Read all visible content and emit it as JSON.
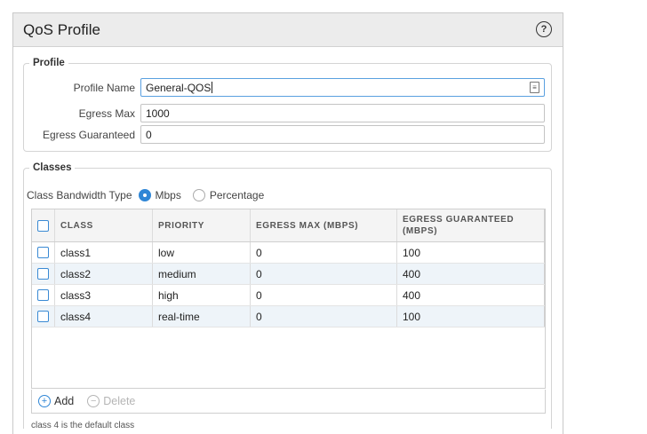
{
  "dialog": {
    "title": "QoS Profile",
    "help_icon": "?"
  },
  "profile": {
    "legend": "Profile",
    "name_label": "Profile Name",
    "name_value": "General-QOS",
    "egress_max_label": "Egress Max",
    "egress_max_value": "1000",
    "egress_guaranteed_label": "Egress Guaranteed",
    "egress_guaranteed_value": "0"
  },
  "classes": {
    "legend": "Classes",
    "bandwidth_label": "Class Bandwidth Type",
    "bandwidth_options": [
      "Mbps",
      "Percentage"
    ],
    "bandwidth_selected": "Mbps",
    "columns": [
      "CLASS",
      "PRIORITY",
      "EGRESS MAX (MBPS)",
      "EGRESS GUARANTEED (MBPS)"
    ],
    "rows": [
      {
        "class": "class1",
        "priority": "low",
        "egress_max": "0",
        "egress_guaranteed": "100"
      },
      {
        "class": "class2",
        "priority": "medium",
        "egress_max": "0",
        "egress_guaranteed": "400"
      },
      {
        "class": "class3",
        "priority": "high",
        "egress_max": "0",
        "egress_guaranteed": "400"
      },
      {
        "class": "class4",
        "priority": "real-time",
        "egress_max": "0",
        "egress_guaranteed": "100"
      }
    ],
    "add_label": "Add",
    "delete_label": "Delete",
    "footnote": "class 4 is the default class"
  },
  "colors": {
    "accent": "#2f86d6",
    "header_bg": "#ececec",
    "alt_row": "#eef4f9"
  }
}
